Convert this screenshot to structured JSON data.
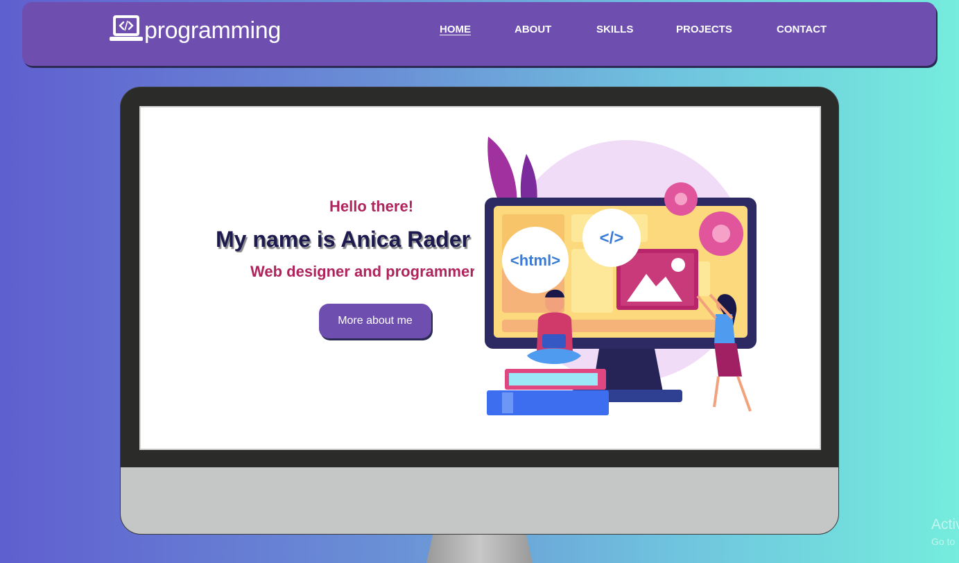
{
  "header": {
    "logo_text": "programming",
    "logo_icon": "laptop-code-icon",
    "nav": [
      {
        "label": "HOME",
        "active": true
      },
      {
        "label": "ABOUT"
      },
      {
        "label": "SKILLS"
      },
      {
        "label": "PROJECTS"
      },
      {
        "label": "CONTACT"
      }
    ]
  },
  "hero": {
    "greeting": "Hello there!",
    "name": "My name is Anica Rader",
    "role": "Web designer and programmer",
    "button_label": "More about me",
    "illustration": {
      "html_badge": "<html>",
      "code_badge": "</>"
    }
  },
  "overlay": {
    "activate_title": "Activ",
    "activate_sub": "Go to"
  },
  "colors": {
    "accent": "#6e4fb0",
    "highlight": "#b0245d",
    "dark_text": "#1c1a4e"
  }
}
